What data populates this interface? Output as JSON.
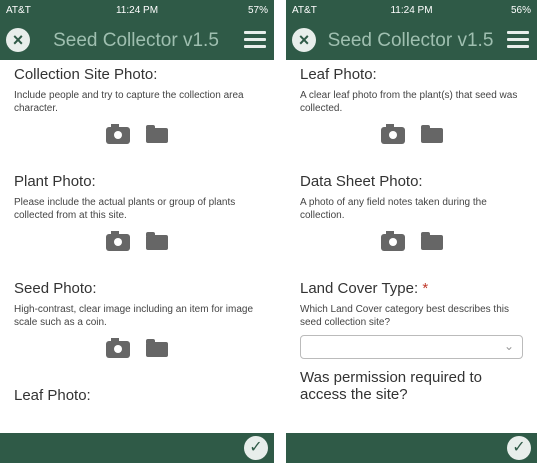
{
  "screens": [
    {
      "status": {
        "carrier": "AT&T",
        "time": "11:24 PM",
        "battery": "57%"
      },
      "app_title": "Seed Collector v1.5",
      "sections": [
        {
          "title": "Collection Site Photo:",
          "desc": "Include people and try to capture the collection area character."
        },
        {
          "title": "Plant Photo:",
          "desc": "Please include the actual plants or group of plants collected from at this site."
        },
        {
          "title": "Seed Photo:",
          "desc": "High-contrast, clear image including an item for image scale such as a coin."
        },
        {
          "title": "Leaf Photo:",
          "desc": ""
        }
      ]
    },
    {
      "status": {
        "carrier": "AT&T",
        "time": "11:24 PM",
        "battery": "56%"
      },
      "app_title": "Seed Collector v1.5",
      "sections": [
        {
          "title": "Leaf Photo:",
          "desc": "A clear leaf photo from the plant(s) that seed was collected."
        },
        {
          "title": "Data Sheet Photo:",
          "desc": "A photo of any field notes taken during the collection."
        }
      ],
      "land_cover": {
        "title": "Land Cover Type:",
        "required_mark": "*",
        "desc": "Which Land Cover category best describes this seed collection site?",
        "value": ""
      },
      "permission": {
        "title": "Was permission required to access the site?"
      }
    }
  ],
  "icons": {
    "close": "close-icon",
    "menu": "hamburger-menu-icon",
    "camera": "camera-icon",
    "folder": "folder-icon",
    "check": "check-icon",
    "chevron": "chevron-down-icon"
  },
  "colors": {
    "header": "#2f5a47",
    "title_text": "#9fbfb0",
    "icon_bg": "#e8eeeb"
  }
}
